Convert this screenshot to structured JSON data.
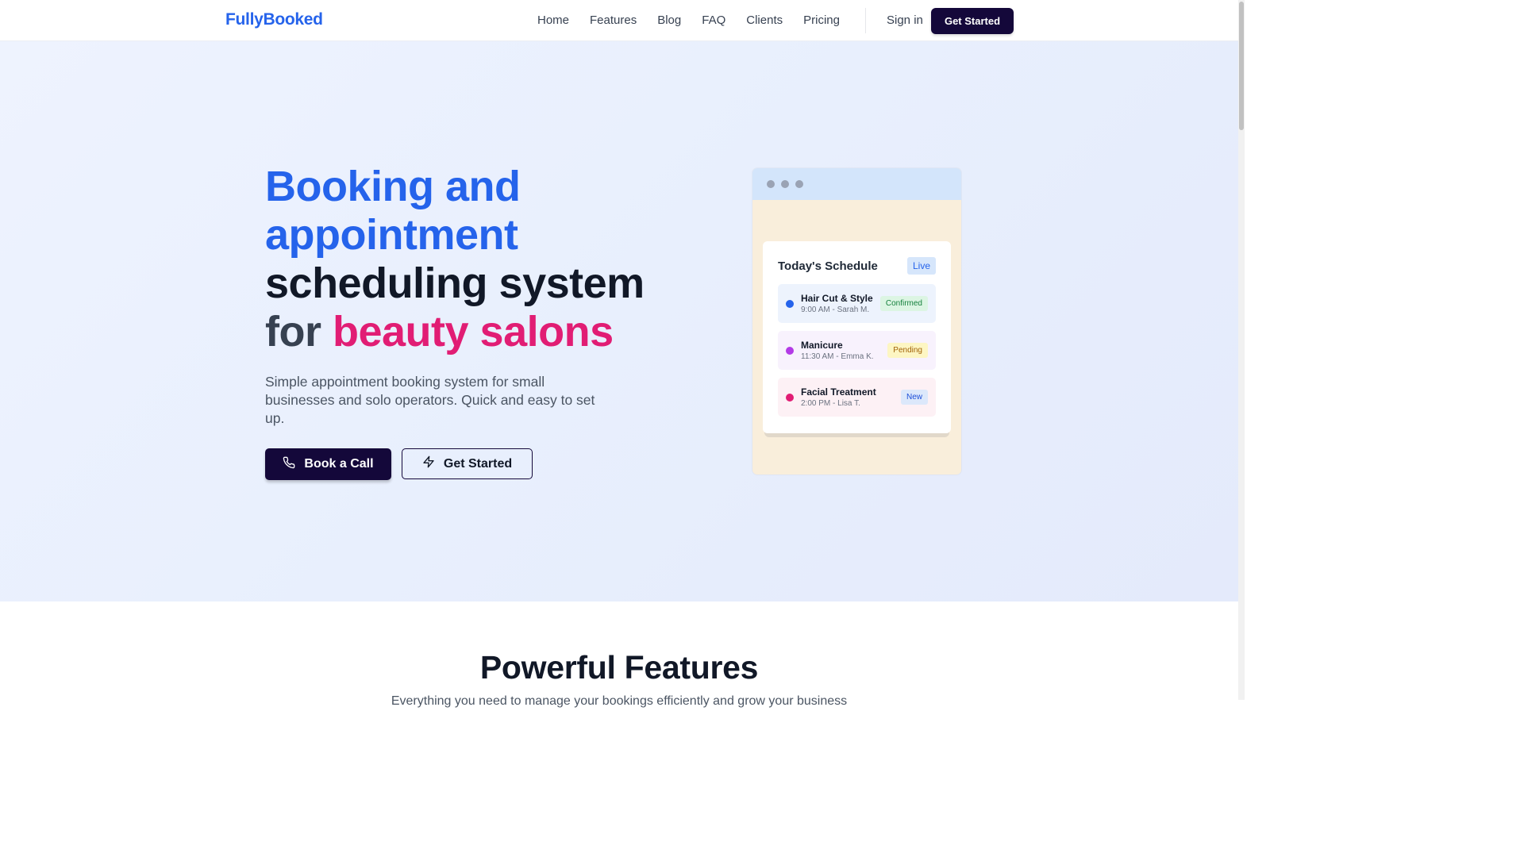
{
  "header": {
    "logo": "FullyBooked",
    "nav": [
      {
        "label": "Home"
      },
      {
        "label": "Features"
      },
      {
        "label": "Blog"
      },
      {
        "label": "FAQ"
      },
      {
        "label": "Clients"
      },
      {
        "label": "Pricing"
      }
    ],
    "signin_label": "Sign in",
    "cta_label": "Get Started"
  },
  "hero": {
    "title_parts": {
      "line1": "Booking and",
      "line2": "appointment",
      "line3": "scheduling system",
      "line4_prefix": "for ",
      "line4_highlight": "beauty salons"
    },
    "subtitle": "Simple appointment booking system for small businesses and solo operators. Quick and easy to set up.",
    "primary_button": {
      "label": "Book a Call",
      "icon": "phone-icon"
    },
    "secondary_button": {
      "label": "Get Started",
      "icon": "lightning-icon"
    }
  },
  "schedule": {
    "title": "Today's Schedule",
    "live_badge": "Live",
    "appointments": [
      {
        "name": "Hair Cut & Style",
        "time": "9:00 AM - Sarah M.",
        "status": "Confirmed",
        "dot_color": "#2563eb",
        "bg": "#edf3fd",
        "badge_bg": "#dcf5e3",
        "badge_color": "#15803d"
      },
      {
        "name": "Manicure",
        "time": "11:30 AM - Emma K.",
        "status": "Pending",
        "dot_color": "#b33ae6",
        "bg": "#f8f2fd",
        "badge_bg": "#fdf6c3",
        "badge_color": "#a16207"
      },
      {
        "name": "Facial Treatment",
        "time": "2:00 PM - Lisa T.",
        "status": "New",
        "dot_color": "#e11d74",
        "bg": "#fdf1f5",
        "badge_bg": "#dce8fb",
        "badge_color": "#1d4ed8"
      }
    ]
  },
  "features": {
    "title": "Powerful Features",
    "subtitle": "Everything you need to manage your bookings efficiently and grow your business"
  },
  "colors": {
    "brand_blue": "#2563eb",
    "brand_pink": "#e11d74",
    "dark_navy": "#14083a"
  }
}
